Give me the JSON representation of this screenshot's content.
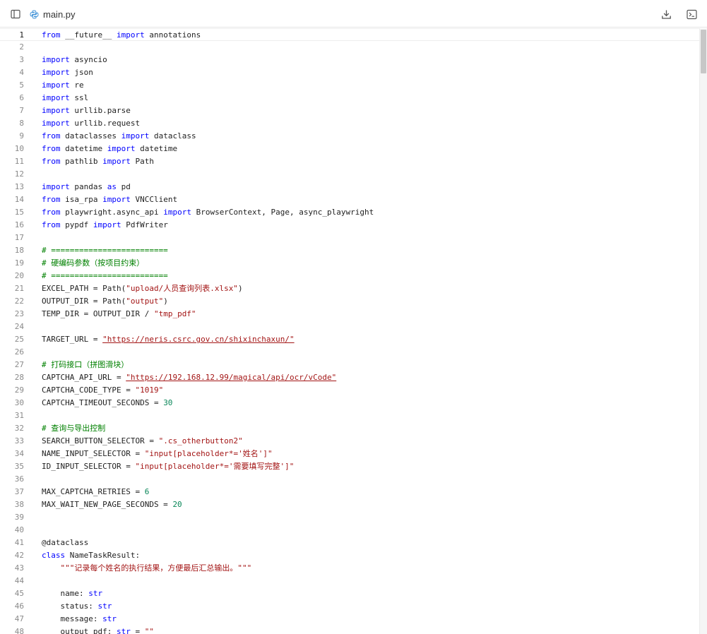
{
  "header": {
    "file_name": "main.py",
    "icons": {
      "sidebar": "sidebar-toggle-icon",
      "python": "python-file-icon",
      "download": "download-icon",
      "terminal": "terminal-icon"
    }
  },
  "colors": {
    "keyword": "#0000ff",
    "string": "#a31515",
    "number": "#098658",
    "comment": "#008000"
  },
  "editor": {
    "current_line": 1,
    "lines": [
      {
        "n": "1",
        "tokens": [
          {
            "t": "from",
            "c": "kw"
          },
          {
            "t": " __future__ "
          },
          {
            "t": "import",
            "c": "kw"
          },
          {
            "t": " annotations"
          }
        ]
      },
      {
        "n": "2",
        "tokens": []
      },
      {
        "n": "3",
        "tokens": [
          {
            "t": "import",
            "c": "kw"
          },
          {
            "t": " asyncio"
          }
        ]
      },
      {
        "n": "4",
        "tokens": [
          {
            "t": "import",
            "c": "kw"
          },
          {
            "t": " json"
          }
        ]
      },
      {
        "n": "5",
        "tokens": [
          {
            "t": "import",
            "c": "kw"
          },
          {
            "t": " re"
          }
        ]
      },
      {
        "n": "6",
        "tokens": [
          {
            "t": "import",
            "c": "kw"
          },
          {
            "t": " ssl"
          }
        ]
      },
      {
        "n": "7",
        "tokens": [
          {
            "t": "import",
            "c": "kw"
          },
          {
            "t": " urllib.parse"
          }
        ]
      },
      {
        "n": "8",
        "tokens": [
          {
            "t": "import",
            "c": "kw"
          },
          {
            "t": " urllib.request"
          }
        ]
      },
      {
        "n": "9",
        "tokens": [
          {
            "t": "from",
            "c": "kw"
          },
          {
            "t": " dataclasses "
          },
          {
            "t": "import",
            "c": "kw"
          },
          {
            "t": " dataclass"
          }
        ]
      },
      {
        "n": "10",
        "tokens": [
          {
            "t": "from",
            "c": "kw"
          },
          {
            "t": " datetime "
          },
          {
            "t": "import",
            "c": "kw"
          },
          {
            "t": " datetime"
          }
        ]
      },
      {
        "n": "11",
        "tokens": [
          {
            "t": "from",
            "c": "kw"
          },
          {
            "t": " pathlib "
          },
          {
            "t": "import",
            "c": "kw"
          },
          {
            "t": " Path"
          }
        ]
      },
      {
        "n": "12",
        "tokens": []
      },
      {
        "n": "13",
        "tokens": [
          {
            "t": "import",
            "c": "kw"
          },
          {
            "t": " pandas "
          },
          {
            "t": "as",
            "c": "kw"
          },
          {
            "t": " pd"
          }
        ]
      },
      {
        "n": "14",
        "tokens": [
          {
            "t": "from",
            "c": "kw"
          },
          {
            "t": " isa_rpa "
          },
          {
            "t": "import",
            "c": "kw"
          },
          {
            "t": " VNCClient"
          }
        ]
      },
      {
        "n": "15",
        "tokens": [
          {
            "t": "from",
            "c": "kw"
          },
          {
            "t": " playwright.async_api "
          },
          {
            "t": "import",
            "c": "kw"
          },
          {
            "t": " BrowserContext, Page, async_playwright"
          }
        ]
      },
      {
        "n": "16",
        "tokens": [
          {
            "t": "from",
            "c": "kw"
          },
          {
            "t": " pypdf "
          },
          {
            "t": "import",
            "c": "kw"
          },
          {
            "t": " PdfWriter"
          }
        ]
      },
      {
        "n": "17",
        "tokens": []
      },
      {
        "n": "18",
        "tokens": [
          {
            "t": "# =========================",
            "c": "cmt"
          }
        ]
      },
      {
        "n": "19",
        "tokens": [
          {
            "t": "# 硬编码参数（按项目约束）",
            "c": "cmt"
          }
        ]
      },
      {
        "n": "20",
        "tokens": [
          {
            "t": "# =========================",
            "c": "cmt"
          }
        ]
      },
      {
        "n": "21",
        "tokens": [
          {
            "t": "EXCEL_PATH = Path("
          },
          {
            "t": "\"upload/人员查询列表.xlsx\"",
            "c": "str"
          },
          {
            "t": ")"
          }
        ]
      },
      {
        "n": "22",
        "tokens": [
          {
            "t": "OUTPUT_DIR = Path("
          },
          {
            "t": "\"output\"",
            "c": "str"
          },
          {
            "t": ")"
          }
        ]
      },
      {
        "n": "23",
        "tokens": [
          {
            "t": "TEMP_DIR = OUTPUT_DIR / "
          },
          {
            "t": "\"tmp_pdf\"",
            "c": "str"
          }
        ]
      },
      {
        "n": "24",
        "tokens": []
      },
      {
        "n": "25",
        "tokens": [
          {
            "t": "TARGET_URL = "
          },
          {
            "t": "\"https://neris.csrc.gov.cn/shixinchaxun/\"",
            "c": "str url"
          }
        ]
      },
      {
        "n": "26",
        "tokens": []
      },
      {
        "n": "27",
        "tokens": [
          {
            "t": "# 打码接口（拼图滑块）",
            "c": "cmt"
          }
        ]
      },
      {
        "n": "28",
        "tokens": [
          {
            "t": "CAPTCHA_API_URL = "
          },
          {
            "t": "\"https://192.168.12.99/magical/api/ocr/vCode\"",
            "c": "str url"
          }
        ]
      },
      {
        "n": "29",
        "tokens": [
          {
            "t": "CAPTCHA_CODE_TYPE = "
          },
          {
            "t": "\"1019\"",
            "c": "str"
          }
        ]
      },
      {
        "n": "30",
        "tokens": [
          {
            "t": "CAPTCHA_TIMEOUT_SECONDS = "
          },
          {
            "t": "30",
            "c": "num"
          }
        ]
      },
      {
        "n": "31",
        "tokens": []
      },
      {
        "n": "32",
        "tokens": [
          {
            "t": "# 查询与导出控制",
            "c": "cmt"
          }
        ]
      },
      {
        "n": "33",
        "tokens": [
          {
            "t": "SEARCH_BUTTON_SELECTOR = "
          },
          {
            "t": "\".cs_otherbutton2\"",
            "c": "str"
          }
        ]
      },
      {
        "n": "34",
        "tokens": [
          {
            "t": "NAME_INPUT_SELECTOR = "
          },
          {
            "t": "\"input[placeholder*='姓名']\"",
            "c": "str"
          }
        ]
      },
      {
        "n": "35",
        "tokens": [
          {
            "t": "ID_INPUT_SELECTOR = "
          },
          {
            "t": "\"input[placeholder*='需要填写完整']\"",
            "c": "str"
          }
        ]
      },
      {
        "n": "36",
        "tokens": []
      },
      {
        "n": "37",
        "tokens": [
          {
            "t": "MAX_CAPTCHA_RETRIES = "
          },
          {
            "t": "6",
            "c": "num"
          }
        ]
      },
      {
        "n": "38",
        "tokens": [
          {
            "t": "MAX_WAIT_NEW_PAGE_SECONDS = "
          },
          {
            "t": "20",
            "c": "num"
          }
        ]
      },
      {
        "n": "39",
        "tokens": []
      },
      {
        "n": "40",
        "tokens": []
      },
      {
        "n": "41",
        "tokens": [
          {
            "t": "@dataclass"
          }
        ]
      },
      {
        "n": "42",
        "tokens": [
          {
            "t": "class",
            "c": "kw"
          },
          {
            "t": " NameTaskResult:"
          }
        ]
      },
      {
        "n": "43",
        "tokens": [
          {
            "t": "    "
          },
          {
            "t": "\"\"\"记录每个姓名的执行结果，方便最后汇总输出。\"\"\"",
            "c": "str"
          }
        ]
      },
      {
        "n": "44",
        "tokens": []
      },
      {
        "n": "45",
        "tokens": [
          {
            "t": "    name: "
          },
          {
            "t": "str",
            "c": "kw"
          }
        ]
      },
      {
        "n": "46",
        "tokens": [
          {
            "t": "    status: "
          },
          {
            "t": "str",
            "c": "kw"
          }
        ]
      },
      {
        "n": "47",
        "tokens": [
          {
            "t": "    message: "
          },
          {
            "t": "str",
            "c": "kw"
          }
        ]
      },
      {
        "n": "48",
        "tokens": [
          {
            "t": "    output_pdf: "
          },
          {
            "t": "str",
            "c": "kw"
          },
          {
            "t": " = "
          },
          {
            "t": "\"\"",
            "c": "str"
          }
        ]
      }
    ]
  }
}
